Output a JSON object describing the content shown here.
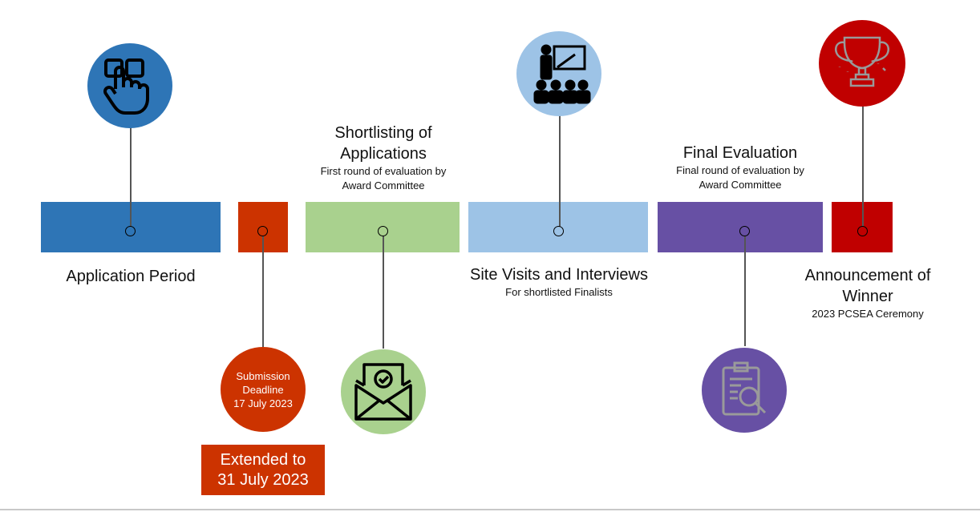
{
  "colors": {
    "application": "#2e75b6",
    "deadline": "#cc3300",
    "shortlisting": "#a9d18e",
    "site_visits": "#9dc3e6",
    "final": "#6750a4",
    "announcement": "#c00000"
  },
  "stages": {
    "application": {
      "title": "Application Period",
      "icon": "hand-pointer-icon"
    },
    "deadline": {
      "circle_line1": "Submission",
      "circle_line2": "Deadline",
      "circle_line3": "17 July 2023",
      "extended_line1": "Extended to",
      "extended_line2": "31 July 2023"
    },
    "shortlisting": {
      "title_line1": "Shortlisting of",
      "title_line2": "Applications",
      "sub_line1": "First round of evaluation by",
      "sub_line2": "Award Committee",
      "icon": "envelope-check-icon"
    },
    "site_visits": {
      "title": "Site Visits and Interviews",
      "sub": "For shortlisted Finalists",
      "icon": "presentation-audience-icon"
    },
    "final": {
      "title": "Final Evaluation",
      "sub_line1": "Final round of evaluation by",
      "sub_line2": "Award Committee",
      "icon": "clipboard-search-icon"
    },
    "announcement": {
      "title_line1": "Announcement of",
      "title_line2": "Winner",
      "sub": "2023 PCSEA Ceremony",
      "icon": "trophy-icon"
    }
  }
}
